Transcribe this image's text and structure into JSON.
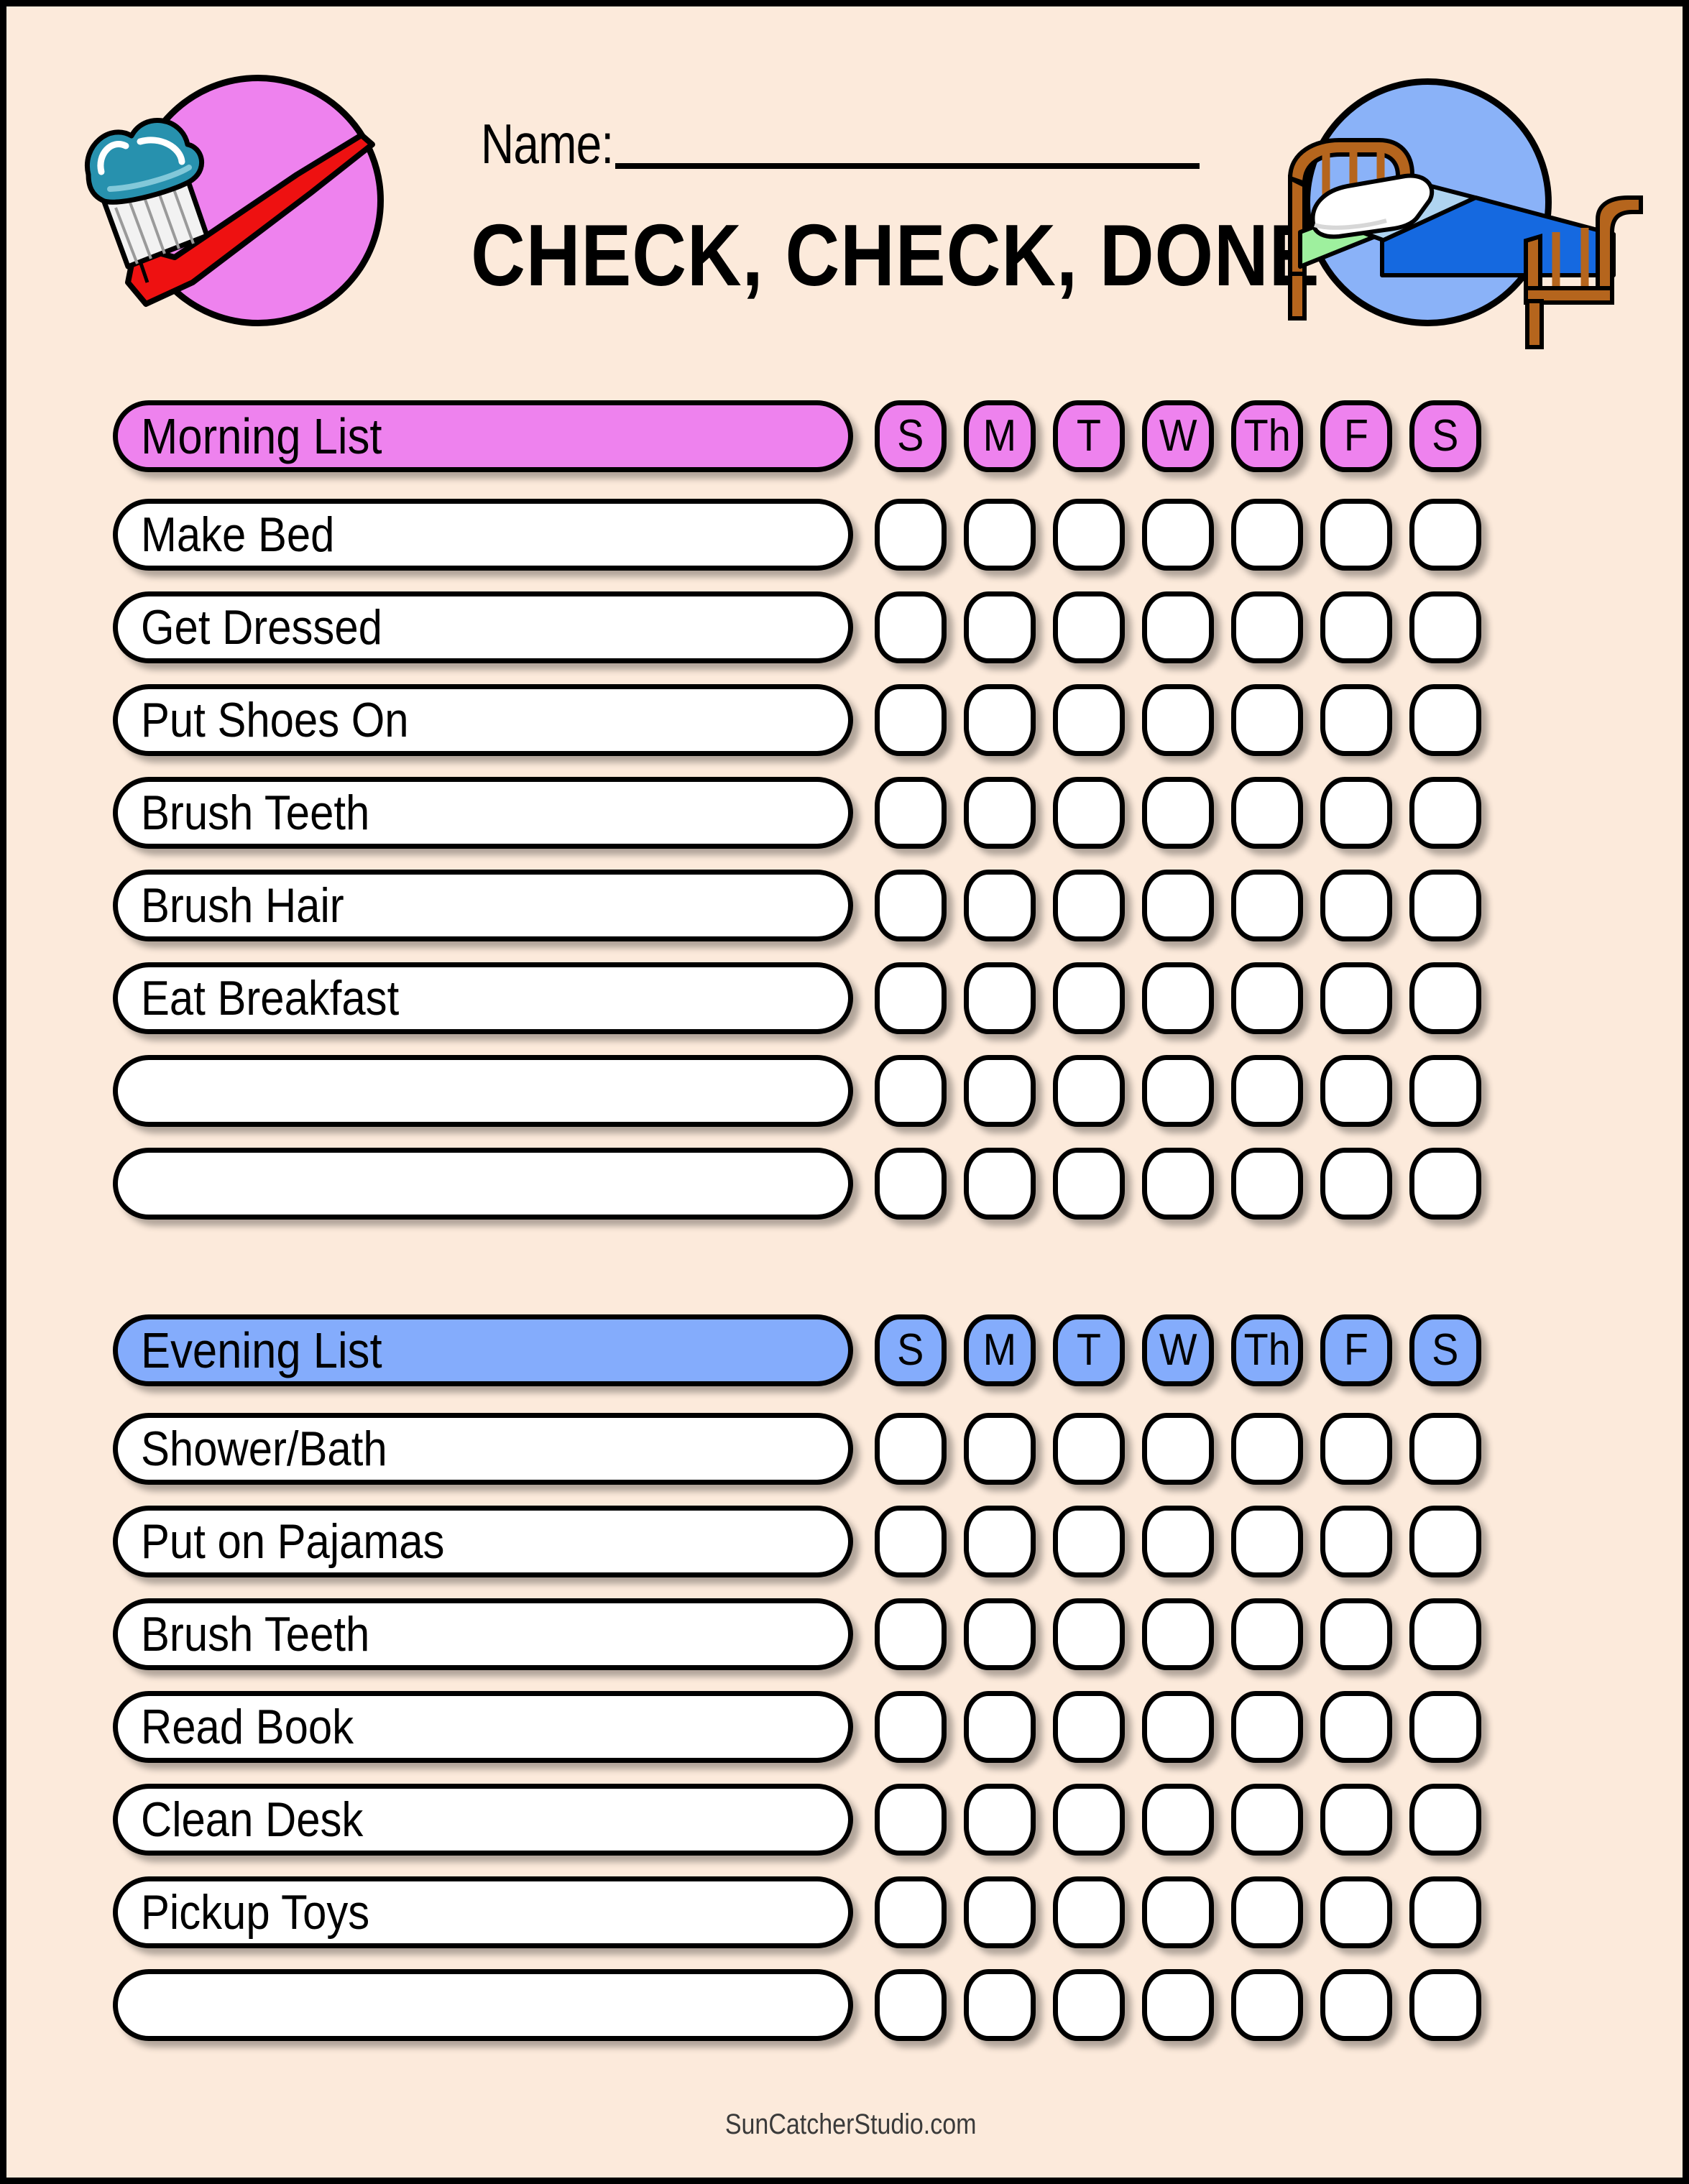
{
  "page": {
    "background_color": "#FCEADB",
    "border_color": "#000000"
  },
  "header": {
    "name_label": "Name:",
    "name_value": "",
    "title": "CHECK, CHECK, DONE",
    "left_icon": "toothbrush-icon",
    "left_icon_badge_color": "#EE82EE",
    "right_icon": "bed-icon",
    "right_icon_badge_color": "#8AB2F8"
  },
  "sections": [
    {
      "id": "morning",
      "title": "Morning List",
      "accent_color": "#EE82EE",
      "days": [
        "S",
        "M",
        "T",
        "W",
        "Th",
        "F",
        "S"
      ],
      "tasks": [
        "Make Bed",
        "Get Dressed",
        "Put Shoes On",
        "Brush Teeth",
        "Brush Hair",
        "Eat Breakfast",
        "",
        ""
      ]
    },
    {
      "id": "evening",
      "title": "Evening List",
      "accent_color": "#84ACFC",
      "days": [
        "S",
        "M",
        "T",
        "W",
        "Th",
        "F",
        "S"
      ],
      "tasks": [
        "Shower/Bath",
        "Put on Pajamas",
        "Brush Teeth",
        "Read Book",
        "Clean Desk",
        "Pickup Toys",
        ""
      ]
    }
  ],
  "footer": {
    "text": "SunCatcherStudio.com"
  }
}
